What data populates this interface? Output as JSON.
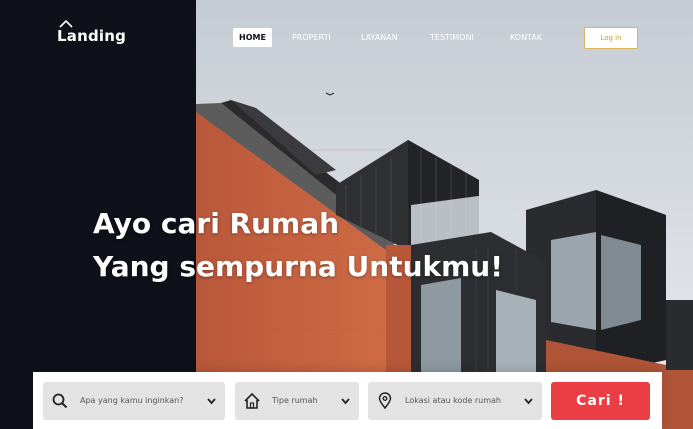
{
  "brand": {
    "logo_text": "Landing"
  },
  "nav": {
    "items": [
      {
        "label": "HOME",
        "active": true
      },
      {
        "label": "PROPERTI",
        "active": false
      },
      {
        "label": "LAYANAN",
        "active": false
      },
      {
        "label": "TESTIMONI",
        "active": false
      },
      {
        "label": "KONTAK",
        "active": false
      }
    ],
    "login_label": "Log in"
  },
  "hero": {
    "headline_line1": "Ayo cari Rumah",
    "headline_line2": "Yang sempurna Untukmu!"
  },
  "search": {
    "keyword_placeholder": "Apa yang kamu inginkan?",
    "type_placeholder": "Tipe rumah",
    "location_placeholder": "Lokasi atau kode rumah",
    "button_label": "Cari !"
  },
  "colors": {
    "dark_panel": "#0e111a",
    "accent": "#ea3d44",
    "login_border": "#d9b65e",
    "brick": "#c2623f"
  }
}
